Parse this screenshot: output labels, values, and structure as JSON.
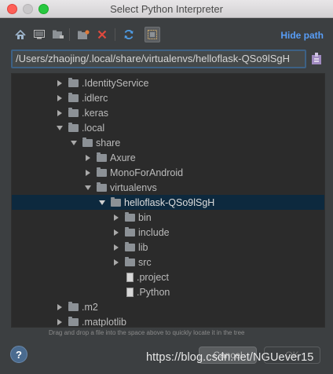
{
  "window": {
    "title": "Select Python Interpreter"
  },
  "toolbar": {
    "hide_path_label": "Hide path",
    "icons": [
      "home-icon",
      "desktop-icon",
      "project-folder-icon",
      "new-folder-icon",
      "delete-icon",
      "refresh-icon",
      "show-hidden-icon"
    ]
  },
  "path_field": {
    "value": "/Users/zhaojing/.local/share/virtualenvs/helloflask-QSo9lSgH"
  },
  "tree": {
    "items": [
      {
        "label": ".IdentityService",
        "type": "folder",
        "state": "collapsed",
        "depth": 0
      },
      {
        "label": ".idlerc",
        "type": "folder",
        "state": "collapsed",
        "depth": 0
      },
      {
        "label": ".keras",
        "type": "folder",
        "state": "collapsed",
        "depth": 0
      },
      {
        "label": ".local",
        "type": "folder",
        "state": "expanded",
        "depth": 0
      },
      {
        "label": "share",
        "type": "folder",
        "state": "expanded",
        "depth": 1
      },
      {
        "label": "Axure",
        "type": "folder",
        "state": "collapsed",
        "depth": 2
      },
      {
        "label": "MonoForAndroid",
        "type": "folder",
        "state": "collapsed",
        "depth": 2
      },
      {
        "label": "virtualenvs",
        "type": "folder",
        "state": "expanded",
        "depth": 2
      },
      {
        "label": "helloflask-QSo9lSgH",
        "type": "folder",
        "state": "expanded",
        "depth": 3,
        "selected": true
      },
      {
        "label": "bin",
        "type": "folder",
        "state": "collapsed",
        "depth": 4
      },
      {
        "label": "include",
        "type": "folder",
        "state": "collapsed",
        "depth": 4
      },
      {
        "label": "lib",
        "type": "folder",
        "state": "collapsed",
        "depth": 4
      },
      {
        "label": "src",
        "type": "folder",
        "state": "collapsed",
        "depth": 4
      },
      {
        "label": ".project",
        "type": "file",
        "state": "none",
        "depth": 4
      },
      {
        "label": ".Python",
        "type": "file",
        "state": "none",
        "depth": 4
      },
      {
        "label": ".m2",
        "type": "folder",
        "state": "collapsed",
        "depth": 0
      },
      {
        "label": ".matplotlib",
        "type": "folder",
        "state": "collapsed",
        "depth": 0
      }
    ]
  },
  "hint_text": "Drag and drop a file into the space above to quickly locate it in the tree",
  "buttons": {
    "help_label": "?",
    "cancel_label": "Cancel",
    "ok_label": "OK"
  },
  "watermark": "https://blog.csdn.net/NGUever15",
  "colors": {
    "background": "#3c3f41",
    "tree_background": "#2b2b2b",
    "selection": "#0d293e",
    "link": "#589df6",
    "focus_border": "#3d6185"
  }
}
